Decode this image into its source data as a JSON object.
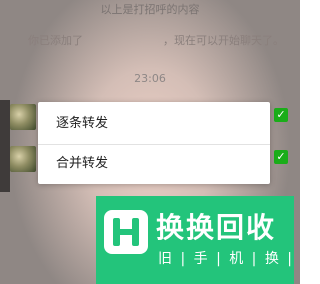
{
  "chat": {
    "notice_text": "以上是打招呼的内容",
    "system_left": "你已添加了",
    "system_right": "，现在可以开始聊天了。",
    "timestamp": "23:06"
  },
  "forward_menu": {
    "items": [
      {
        "label": "逐条转发"
      },
      {
        "label": "合并转发"
      }
    ]
  },
  "selection": {
    "check_glyph": "✓",
    "check_color": "#1aad19"
  },
  "watermark": {
    "title": "换换回收",
    "subtitle": "旧 | 手 | 机 | 换 | 钱",
    "logo_icon": "h-logo-icon",
    "color": "#23c47b"
  }
}
